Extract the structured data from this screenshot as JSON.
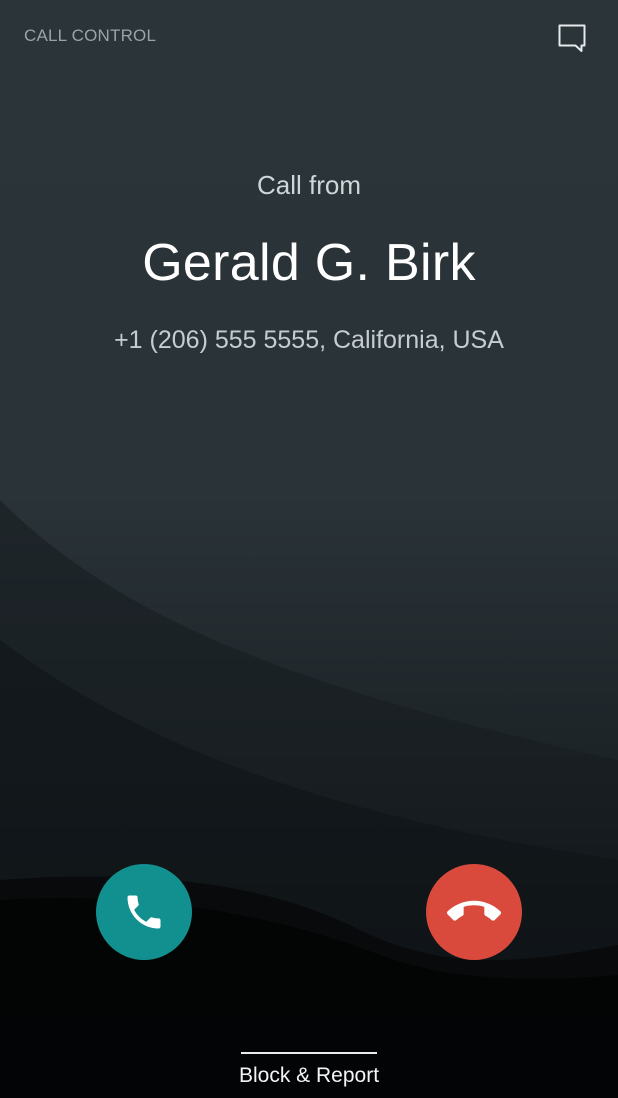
{
  "header": {
    "label": "CALL CONTROL",
    "message_icon": "chat-bubble-icon"
  },
  "caller": {
    "prefix": "Call from",
    "name": "Gerald G. Birk",
    "number_location": "+1 (206) 555 5555, California, USA"
  },
  "actions": {
    "answer_icon": "phone-icon",
    "answer_color": "#128f8f",
    "decline_icon": "hang-up-icon",
    "decline_color": "#d94a3c",
    "block_report_label": "Block & Report"
  }
}
